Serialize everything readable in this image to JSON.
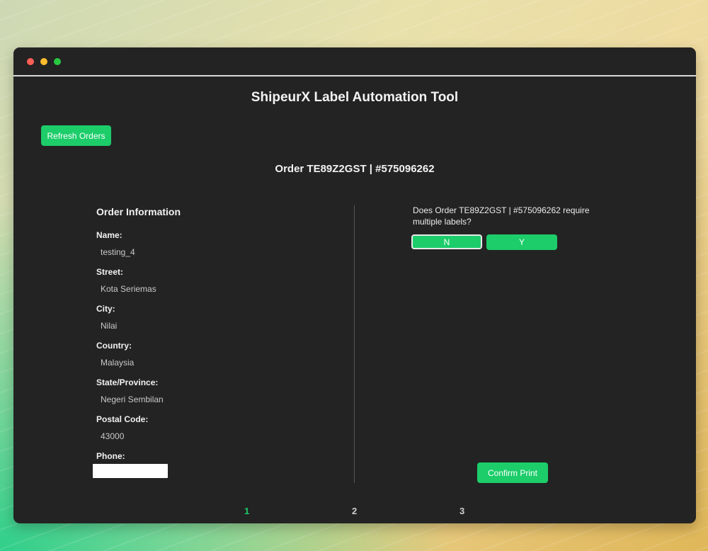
{
  "app": {
    "title": "ShipeurX Label Automation Tool",
    "refresh_label": "Refresh Orders",
    "order_heading": "Order TE89Z2GST | #575096262"
  },
  "order_info": {
    "title": "Order Information",
    "fields": [
      {
        "label": "Name:",
        "value": "testing_4"
      },
      {
        "label": "Street:",
        "value": "Kota Seriemas"
      },
      {
        "label": "City:",
        "value": "Nilai"
      },
      {
        "label": "Country:",
        "value": "Malaysia"
      },
      {
        "label": "State/Province:",
        "value": "Negeri Sembilan"
      },
      {
        "label": "Postal Code:",
        "value": "43000"
      }
    ],
    "phone_label": "Phone:",
    "phone_value": ""
  },
  "labels_prompt": {
    "question": "Does Order TE89Z2GST | #575096262 require multiple labels?",
    "no_label": "N",
    "yes_label": "Y",
    "confirm_label": "Confirm Print"
  },
  "pagination": {
    "pages": [
      "1",
      "2",
      "3"
    ],
    "active": "1"
  },
  "colors": {
    "accent": "#1ccd6a",
    "window_bg": "#232323"
  }
}
